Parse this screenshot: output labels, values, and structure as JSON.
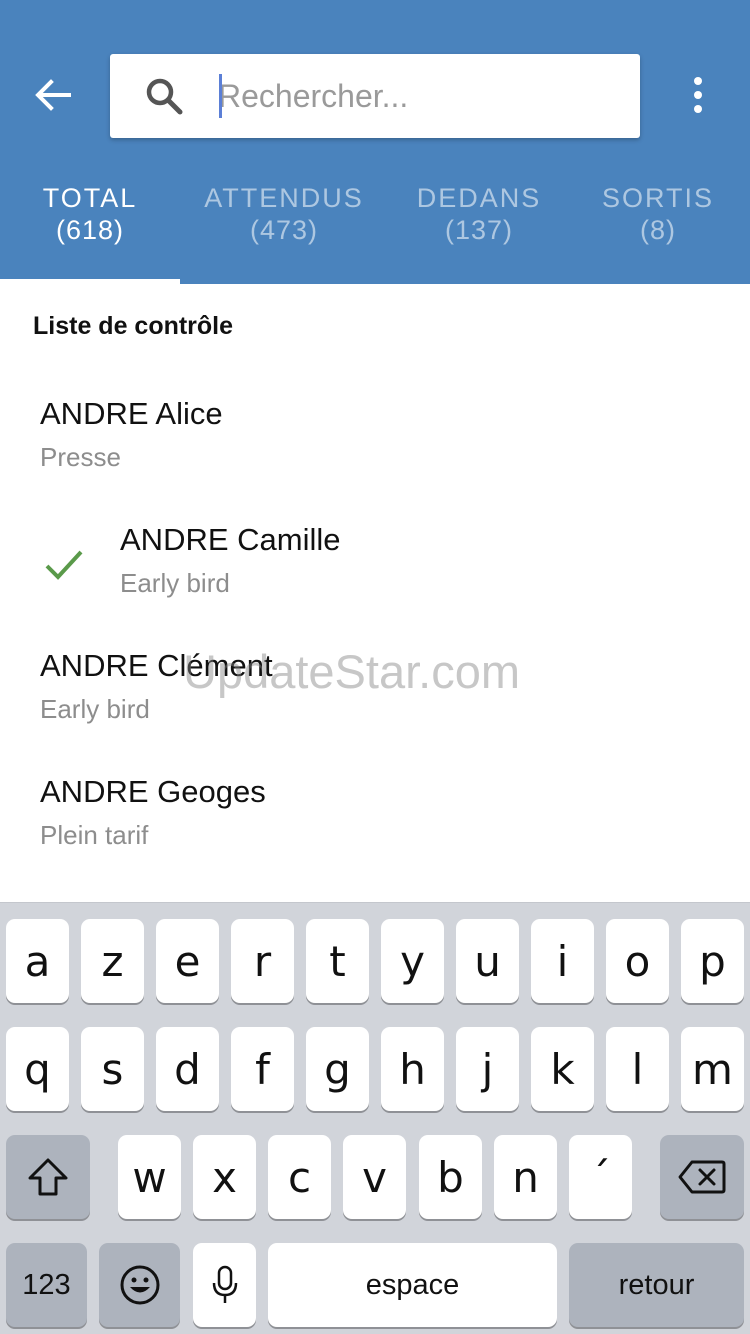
{
  "search": {
    "placeholder": "Rechercher..."
  },
  "tabs": [
    {
      "label": "TOTAL",
      "count": "(618)",
      "active": true
    },
    {
      "label": "ATTENDUS",
      "count": "(473)",
      "active": false
    },
    {
      "label": "DEDANS",
      "count": "(137)",
      "active": false
    },
    {
      "label": "SORTIS",
      "count": "(8)",
      "active": false
    }
  ],
  "list": {
    "title": "Liste de contrôle",
    "items": [
      {
        "name": "ANDRE Alice",
        "category": "Presse",
        "checked": false
      },
      {
        "name": "ANDRE Camille",
        "category": "Early bird",
        "checked": true
      },
      {
        "name": "ANDRE Clément",
        "category": "Early bird",
        "checked": false
      },
      {
        "name": "ANDRE Geoges",
        "category": "Plein tarif",
        "checked": false
      }
    ]
  },
  "watermark": "UpdateStar.com",
  "keyboard": {
    "row1": [
      "a",
      "z",
      "e",
      "r",
      "t",
      "y",
      "u",
      "i",
      "o",
      "p"
    ],
    "row2": [
      "q",
      "s",
      "d",
      "f",
      "g",
      "h",
      "j",
      "k",
      "l",
      "m"
    ],
    "row3": [
      "w",
      "x",
      "c",
      "v",
      "b",
      "n",
      "´"
    ],
    "numbers_label": "123",
    "space_label": "espace",
    "return_label": "retour"
  },
  "colors": {
    "header": "#4a83bd",
    "check": "#5a9a4a",
    "keyboard_bg": "#d1d4da"
  },
  "icons": {
    "back": "arrow-left-icon",
    "search": "search-icon",
    "more": "more-vertical-icon",
    "check": "check-icon",
    "shift": "shift-icon",
    "delete": "backspace-icon",
    "emoji": "emoji-icon",
    "mic": "microphone-icon"
  }
}
